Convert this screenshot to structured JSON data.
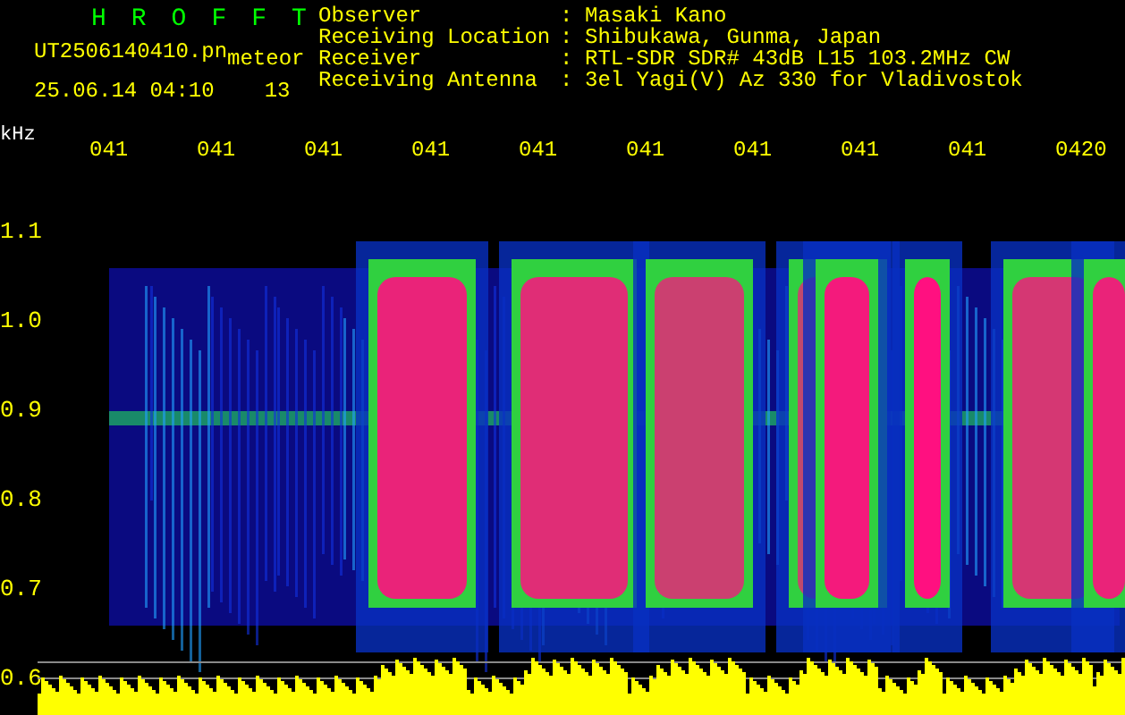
{
  "header": {
    "title": "HROFFT",
    "file": "UT2506140410.pn",
    "tag": "meteor",
    "datetime": "25.06.14 04:10",
    "number": "13"
  },
  "info": [
    {
      "label": "Observer",
      "separator": ":",
      "value": "Masaki Kano"
    },
    {
      "label": "Receiving Location",
      "separator": ":",
      "value": "Shibukawa, Gunma, Japan"
    },
    {
      "label": "Receiver",
      "separator": ":",
      "value": "RTL-SDR SDR# 43dB L15 103.2MHz CW"
    },
    {
      "label": "Receiving Antenna",
      "separator": ":",
      "value": "3el Yagi(V) Az 330 for Vladivostok"
    }
  ],
  "axis": {
    "unit": "kHz",
    "y_labels": [
      "1.1",
      "1.0",
      "0.9",
      "0.8",
      "0.7",
      "0.6"
    ]
  },
  "time_labels": [
    "041",
    "041",
    "041",
    "041",
    "041",
    "041",
    "041",
    "041",
    "041",
    "0420"
  ]
}
